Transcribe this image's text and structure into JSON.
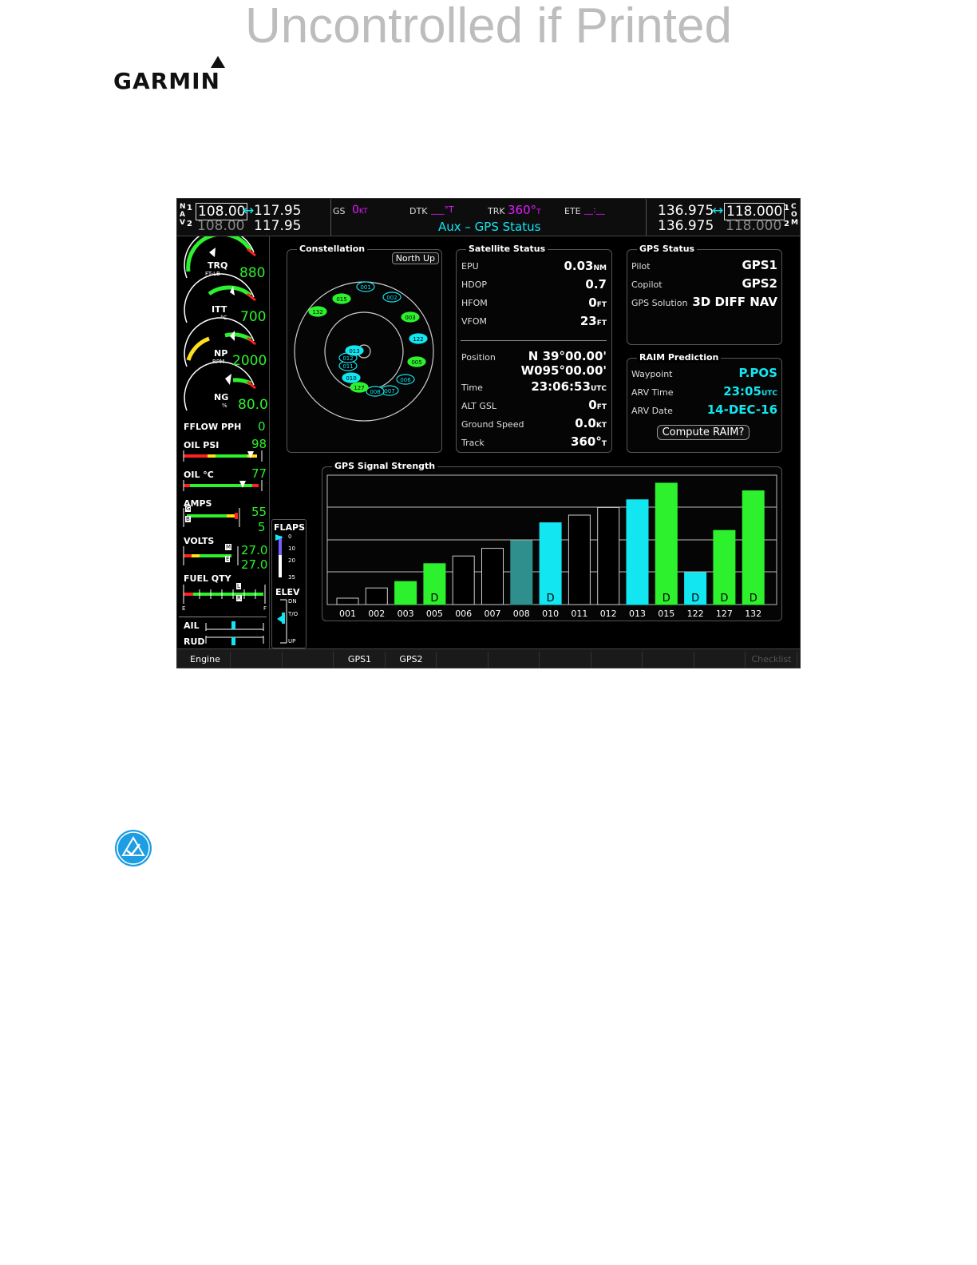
{
  "watermark": "Uncontrolled if Printed",
  "logo": {
    "text": "GARMIN"
  },
  "screen": {
    "topbar": {
      "nav_labels": [
        "N",
        "A",
        "V"
      ],
      "nav1_label": "1",
      "nav2_label": "2",
      "nav1_active": "108.00",
      "nav1_standby": "117.95",
      "nav2_active": "108.00",
      "nav2_standby": "117.95",
      "gs_label": "GS",
      "gs_value": "0",
      "gs_unit": "KT",
      "dtk_label": "DTK",
      "dtk_value": "___°T",
      "trk_label": "TRK",
      "trk_value": "360°",
      "trk_unit": "T",
      "ete_label": "ETE",
      "ete_value": "__:__",
      "page_title": "Aux – GPS Status",
      "com1_standby": "136.975",
      "com1_active": "118.000",
      "com2_standby": "136.975",
      "com2_active": "118.000",
      "com_labels": [
        "C",
        "O",
        "M"
      ],
      "com1_label": "1",
      "com2_label": "2"
    },
    "engine": {
      "trq_label": "TRQ",
      "trq_unit": "FT-LB",
      "trq_value": "880",
      "itt_label": "ITT",
      "itt_unit": "°C",
      "itt_value": "700",
      "np_label": "NP",
      "np_unit": "RPM",
      "np_value": "2000",
      "ng_label": "NG",
      "ng_unit": "%",
      "ng_value": "80.0",
      "fflow_label": "FFLOW PPH",
      "fflow_value": "0",
      "oil_psi_label": "OIL PSI",
      "oil_psi_value": "98",
      "oil_c_label": "OIL °C",
      "oil_c_value": "77",
      "amps_label": "AMPS",
      "amps_value_1": "55",
      "amps_value_2": "5",
      "amps_marker_1": "G",
      "amps_marker_2": "B",
      "volts_label": "VOLTS",
      "volts_value_1": "27.0",
      "volts_value_2": "27.0",
      "volts_marker_1": "M",
      "volts_marker_2": "E",
      "fuel_label": "FUEL QTY",
      "fuel_marker_1": "L",
      "fuel_marker_2": "R",
      "fuel_e": "E",
      "fuel_f": "F",
      "ail_label": "AIL",
      "rud_label": "RUD",
      "flaps_label": "FLAPS",
      "flaps_ticks": [
        "0",
        "10",
        "20",
        "35"
      ],
      "elev_label": "ELEV",
      "elev_ticks": [
        "DN",
        "T/O",
        "UP"
      ]
    },
    "constellation": {
      "title": "Constellation",
      "north_up": "North Up",
      "sats": [
        {
          "id": "001",
          "color": "#000",
          "stroke": "#12e6f0"
        },
        {
          "id": "002",
          "color": "#000",
          "stroke": "#12e6f0"
        },
        {
          "id": "003",
          "color": "#2df12d",
          "stroke": "#2df12d"
        },
        {
          "id": "005",
          "color": "#2df12d",
          "stroke": "#2df12d"
        },
        {
          "id": "006",
          "color": "#000",
          "stroke": "#12e6f0"
        },
        {
          "id": "007",
          "color": "#000",
          "stroke": "#12e6f0"
        },
        {
          "id": "008",
          "color": "#000",
          "stroke": "#12e6f0"
        },
        {
          "id": "010",
          "color": "#12e6f0",
          "stroke": "#12e6f0"
        },
        {
          "id": "011",
          "color": "#000",
          "stroke": "#12e6f0"
        },
        {
          "id": "012",
          "color": "#000",
          "stroke": "#12e6f0"
        },
        {
          "id": "013",
          "color": "#12e6f0",
          "stroke": "#12e6f0"
        },
        {
          "id": "015",
          "color": "#2df12d",
          "stroke": "#2df12d"
        },
        {
          "id": "122",
          "color": "#12e6f0",
          "stroke": "#12e6f0"
        },
        {
          "id": "127",
          "color": "#2df12d",
          "stroke": "#2df12d"
        },
        {
          "id": "132",
          "color": "#2df12d",
          "stroke": "#2df12d"
        }
      ]
    },
    "satellite_status": {
      "title": "Satellite Status",
      "epu_label": "EPU",
      "epu_value": "0.03",
      "epu_unit": "NM",
      "hdop_label": "HDOP",
      "hdop_value": "0.7",
      "hfom_label": "HFOM",
      "hfom_value": "0",
      "hfom_unit": "FT",
      "vfom_label": "VFOM",
      "vfom_value": "23",
      "vfom_unit": "FT",
      "position_label": "Position",
      "position_lat": "N  39°00.00'",
      "position_lon": "W095°00.00'",
      "time_label": "Time",
      "time_value": "23:06:53",
      "time_unit": "UTC",
      "alt_label": "ALT GSL",
      "alt_value": "0",
      "alt_unit": "FT",
      "gs_label": "Ground Speed",
      "gs_value": "0.0",
      "gs_unit": "KT",
      "track_label": "Track",
      "track_value": "360°",
      "track_unit": "T"
    },
    "gps_status": {
      "title": "GPS Status",
      "pilot_label": "Pilot",
      "pilot_value": "GPS1",
      "copilot_label": "Copilot",
      "copilot_value": "GPS2",
      "solution_label": "GPS Solution",
      "solution_value": "3D DIFF NAV"
    },
    "raim": {
      "title": "RAIM Prediction",
      "waypoint_label": "Waypoint",
      "waypoint_value": "P.POS",
      "arv_time_label": "ARV Time",
      "arv_time_value": "23:05",
      "arv_time_unit": "UTC",
      "arv_date_label": "ARV Date",
      "arv_date_value": "14-DEC-16",
      "compute_button": "Compute RAIM?"
    },
    "signal": {
      "title": "GPS Signal Strength",
      "diff_label": "D"
    },
    "softkeys": [
      "Engine",
      "",
      "",
      "GPS1",
      "GPS2",
      "",
      "",
      "",
      "",
      "",
      "",
      "Checklist"
    ]
  },
  "chart_data": {
    "type": "bar",
    "title": "GPS Signal Strength",
    "categories": [
      "001",
      "002",
      "003",
      "005",
      "006",
      "007",
      "008",
      "010",
      "011",
      "012",
      "013",
      "015",
      "122",
      "127",
      "132"
    ],
    "values": [
      5,
      13,
      18,
      32,
      38,
      44,
      50,
      64,
      70,
      76,
      82,
      95,
      25,
      58,
      89
    ],
    "ylim": [
      0,
      100
    ],
    "fill": [
      "none",
      "none",
      "green",
      "green",
      "none",
      "none",
      "teal",
      "cyan",
      "none",
      "none",
      "cyan",
      "green",
      "cyan",
      "green",
      "green"
    ],
    "differential": [
      false,
      false,
      false,
      true,
      false,
      false,
      false,
      true,
      false,
      false,
      false,
      true,
      true,
      true,
      true
    ],
    "colors": {
      "green": "#2df12d",
      "cyan": "#12e6f0",
      "teal": "#2f8f8c",
      "none": "#000000"
    },
    "grid": true
  }
}
